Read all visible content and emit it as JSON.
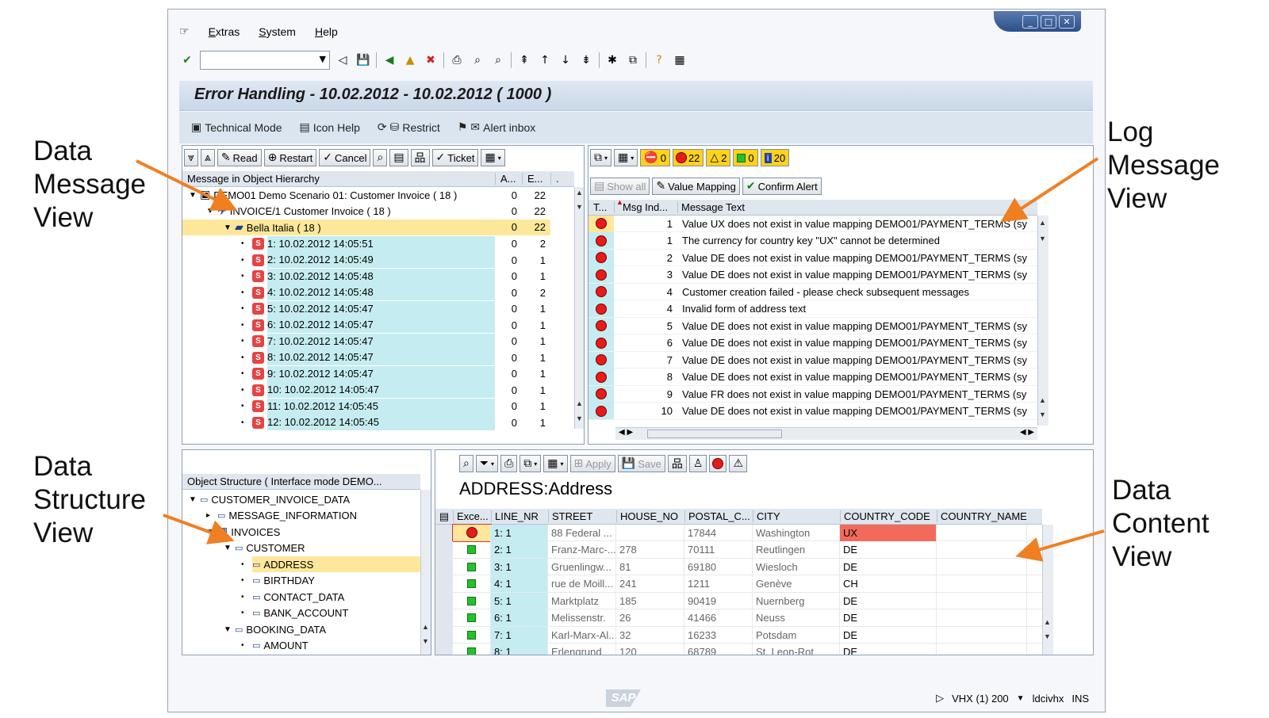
{
  "callouts": {
    "data_message_view": [
      "Data",
      "Message",
      "View"
    ],
    "log_message_view": [
      "Log",
      "Message",
      "View"
    ],
    "data_structure_view": [
      "Data",
      "Structure",
      "View"
    ],
    "data_content_view": [
      "Data",
      "Content",
      "View"
    ]
  },
  "menu": [
    "Extras",
    "System",
    "Help"
  ],
  "window_title": "Error Handling - 10.02.2012 - 10.02.2012 ( 1000 )",
  "app_toolbar": [
    "Technical Mode",
    "Icon Help",
    "Restrict",
    "Alert inbox"
  ],
  "hierarchy": {
    "buttons": [
      "Read",
      "Restart",
      "Cancel",
      "Ticket"
    ],
    "columns": [
      "Message in Object Hierarchy",
      "A...",
      "E...",
      "."
    ],
    "rows": [
      {
        "label": "DEMO01 Demo Scenario 01: Customer Invoice ( 18 )",
        "a": "0",
        "e": "22",
        "indent": 8,
        "style": "plain",
        "icon": "scenario"
      },
      {
        "label": "INVOICE/1 Customer Invoice ( 18 )",
        "a": "0",
        "e": "22",
        "indent": 30,
        "style": "plain",
        "icon": "invoice"
      },
      {
        "label": "Bella Italia ( 18 )",
        "a": "0",
        "e": "22",
        "indent": 52,
        "style": "yellow",
        "icon": "folder"
      },
      {
        "label": "1: 10.02.2012 14:05:51",
        "a": "0",
        "e": "2",
        "indent": 74,
        "style": "cyan",
        "icon": "err"
      },
      {
        "label": "2: 10.02.2012 14:05:49",
        "a": "0",
        "e": "1",
        "indent": 74,
        "style": "cyan",
        "icon": "err"
      },
      {
        "label": "3: 10.02.2012 14:05:48",
        "a": "0",
        "e": "1",
        "indent": 74,
        "style": "cyan",
        "icon": "err"
      },
      {
        "label": "4: 10.02.2012 14:05:48",
        "a": "0",
        "e": "2",
        "indent": 74,
        "style": "cyan",
        "icon": "err"
      },
      {
        "label": "5: 10.02.2012 14:05:47",
        "a": "0",
        "e": "1",
        "indent": 74,
        "style": "cyan",
        "icon": "err"
      },
      {
        "label": "6: 10.02.2012 14:05:47",
        "a": "0",
        "e": "1",
        "indent": 74,
        "style": "cyan",
        "icon": "err"
      },
      {
        "label": "7: 10.02.2012 14:05:47",
        "a": "0",
        "e": "1",
        "indent": 74,
        "style": "cyan",
        "icon": "err"
      },
      {
        "label": "8: 10.02.2012 14:05:47",
        "a": "0",
        "e": "1",
        "indent": 74,
        "style": "cyan",
        "icon": "err"
      },
      {
        "label": "9: 10.02.2012 14:05:47",
        "a": "0",
        "e": "1",
        "indent": 74,
        "style": "cyan",
        "icon": "err"
      },
      {
        "label": "10: 10.02.2012 14:05:47",
        "a": "0",
        "e": "1",
        "indent": 74,
        "style": "cyan",
        "icon": "err"
      },
      {
        "label": "11: 10.02.2012 14:05:45",
        "a": "0",
        "e": "1",
        "indent": 74,
        "style": "cyan",
        "icon": "err"
      },
      {
        "label": "12: 10.02.2012 14:05:45",
        "a": "0",
        "e": "1",
        "indent": 74,
        "style": "cyan",
        "icon": "err"
      }
    ]
  },
  "log": {
    "counters": [
      "0",
      "22",
      "2",
      "0",
      "20"
    ],
    "buttons": [
      "Show all",
      "Value Mapping",
      "Confirm Alert"
    ],
    "columns": [
      "T...",
      "Msg Ind...",
      "Message Text"
    ],
    "rows": [
      {
        "ind": "1",
        "text": "Value UX does not exist in value mapping DEMO01/PAYMENT_TERMS (sy"
      },
      {
        "ind": "1",
        "text": "The currency for country key \"UX\" cannot be determined"
      },
      {
        "ind": "2",
        "text": "Value DE does not exist in value mapping DEMO01/PAYMENT_TERMS (sy"
      },
      {
        "ind": "3",
        "text": "Value DE does not exist in value mapping DEMO01/PAYMENT_TERMS (sy"
      },
      {
        "ind": "4",
        "text": "Customer creation failed - please check subsequent messages"
      },
      {
        "ind": "4",
        "text": "Invalid form of address text"
      },
      {
        "ind": "5",
        "text": "Value DE does not exist in value mapping DEMO01/PAYMENT_TERMS (sy"
      },
      {
        "ind": "6",
        "text": "Value DE does not exist in value mapping DEMO01/PAYMENT_TERMS (sy"
      },
      {
        "ind": "7",
        "text": "Value DE does not exist in value mapping DEMO01/PAYMENT_TERMS (sy"
      },
      {
        "ind": "8",
        "text": "Value DE does not exist in value mapping DEMO01/PAYMENT_TERMS (sy"
      },
      {
        "ind": "9",
        "text": "Value FR does not exist in value mapping DEMO01/PAYMENT_TERMS (sy"
      },
      {
        "ind": "10",
        "text": "Value DE does not exist in value mapping DEMO01/PAYMENT_TERMS (sy"
      }
    ]
  },
  "structure": {
    "header": "Object Structure ( Interface mode DEMO...",
    "rows": [
      {
        "label": "CUSTOMER_INVOICE_DATA",
        "indent": 8,
        "style": "plain",
        "toggle": "▼"
      },
      {
        "label": "MESSAGE_INFORMATION",
        "indent": 30,
        "style": "plain",
        "toggle": "▸"
      },
      {
        "label": "INVOICES",
        "indent": 30,
        "style": "plain",
        "toggle": "▼"
      },
      {
        "label": "CUSTOMER",
        "indent": 52,
        "style": "plain",
        "toggle": "▼"
      },
      {
        "label": "ADDRESS",
        "indent": 74,
        "style": "yellow",
        "toggle": "•"
      },
      {
        "label": "BIRTHDAY",
        "indent": 74,
        "style": "plain",
        "toggle": "•"
      },
      {
        "label": "CONTACT_DATA",
        "indent": 74,
        "style": "plain",
        "toggle": "•"
      },
      {
        "label": "BANK_ACCOUNT",
        "indent": 74,
        "style": "plain",
        "toggle": "•"
      },
      {
        "label": "BOOKING_DATA",
        "indent": 52,
        "style": "plain",
        "toggle": "▼"
      },
      {
        "label": "AMOUNT",
        "indent": 74,
        "style": "plain",
        "toggle": "•"
      }
    ]
  },
  "content": {
    "buttons": [
      "Apply",
      "Save"
    ],
    "title": "ADDRESS:Address",
    "columns": [
      "Exce...",
      "LINE_NR",
      "STREET",
      "HOUSE_NO",
      "POSTAL_C...",
      "CITY",
      "COUNTRY_CODE",
      "COUNTRY_NAME"
    ],
    "rows": [
      {
        "status": "error",
        "line": "1: 1",
        "street": "88 Federal ...",
        "house": "",
        "postal": "17844",
        "city": "Washington",
        "cc": "UX"
      },
      {
        "status": "ok",
        "line": "2: 1",
        "street": "Franz-Marc-...",
        "house": "278",
        "postal": "70111",
        "city": "Reutlingen",
        "cc": "DE"
      },
      {
        "status": "ok",
        "line": "3: 1",
        "street": "Gruenlingw...",
        "house": "81",
        "postal": "69180",
        "city": "Wiesloch",
        "cc": "DE"
      },
      {
        "status": "ok",
        "line": "4: 1",
        "street": "rue de Moill...",
        "house": "241",
        "postal": "1211",
        "city": "Genève",
        "cc": "CH"
      },
      {
        "status": "ok",
        "line": "5: 1",
        "street": "Marktplatz",
        "house": "185",
        "postal": "90419",
        "city": "Nuernberg",
        "cc": "DE"
      },
      {
        "status": "ok",
        "line": "6: 1",
        "street": "Melissenstr.",
        "house": "26",
        "postal": "41466",
        "city": "Neuss",
        "cc": "DE"
      },
      {
        "status": "ok",
        "line": "7: 1",
        "street": "Karl-Marx-Al...",
        "house": "32",
        "postal": "16233",
        "city": "Potsdam",
        "cc": "DE"
      },
      {
        "status": "ok",
        "line": "8: 1",
        "street": "Erlengrund",
        "house": "120",
        "postal": "68789",
        "city": "St. Leon-Rot",
        "cc": "DE"
      }
    ]
  },
  "status": {
    "system": "VHX (1) 200",
    "host": "ldcivhx",
    "mode": "INS"
  },
  "colors": {
    "arrow": "#f07f22",
    "error_cell": "#f26a5b",
    "cyan": "#c5ecf0",
    "highlight": "#fde79a"
  }
}
